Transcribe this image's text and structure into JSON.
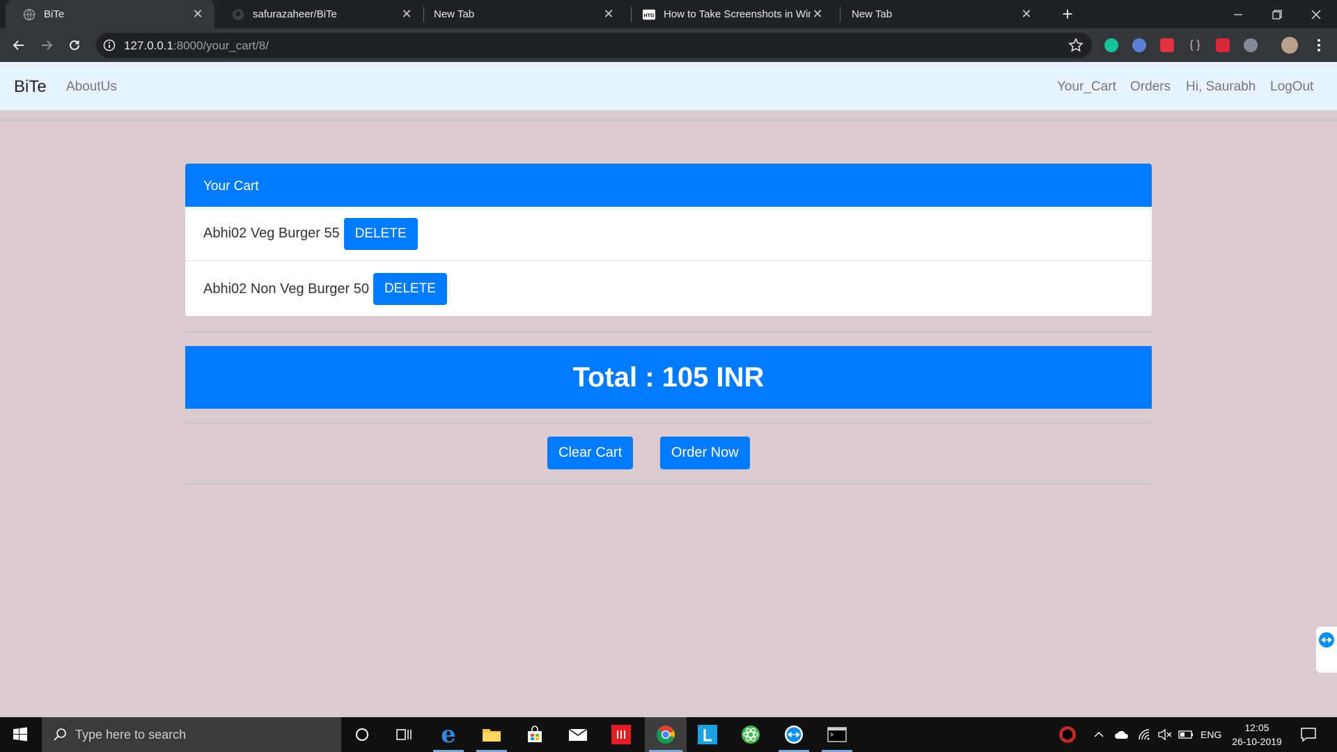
{
  "browser": {
    "tabs": [
      {
        "title": "BiTe",
        "active": true
      },
      {
        "title": "safurazaheer/BiTe",
        "active": false
      },
      {
        "title": "New Tab",
        "active": false
      },
      {
        "title": "How to Take Screenshots in Wind",
        "active": false
      },
      {
        "title": "New Tab",
        "active": false
      }
    ],
    "url_host": "127.0.0.1",
    "url_rest": ":8000/your_cart/8/"
  },
  "navbar": {
    "brand": "BiTe",
    "about": "AboutUs",
    "cart": "Your_Cart",
    "orders": "Orders",
    "greeting": "Hi, Saurabh",
    "logout": "LogOut"
  },
  "cart": {
    "header": "Your Cart",
    "items": [
      {
        "label": "Abhi02 Veg Burger 55",
        "button": "DELETE"
      },
      {
        "label": "Abhi02 Non Veg Burger 50",
        "button": "DELETE"
      }
    ],
    "total": "Total : 105 INR",
    "clear_button": "Clear Cart",
    "order_button": "Order Now"
  },
  "taskbar": {
    "search_placeholder": "Type here to search",
    "language": "ENG",
    "time": "12:05",
    "date": "26-10-2019"
  },
  "colors": {
    "primary": "#007bff",
    "page_bg": "#d9cbd0",
    "navbar_bg": "#e6f2fd"
  }
}
